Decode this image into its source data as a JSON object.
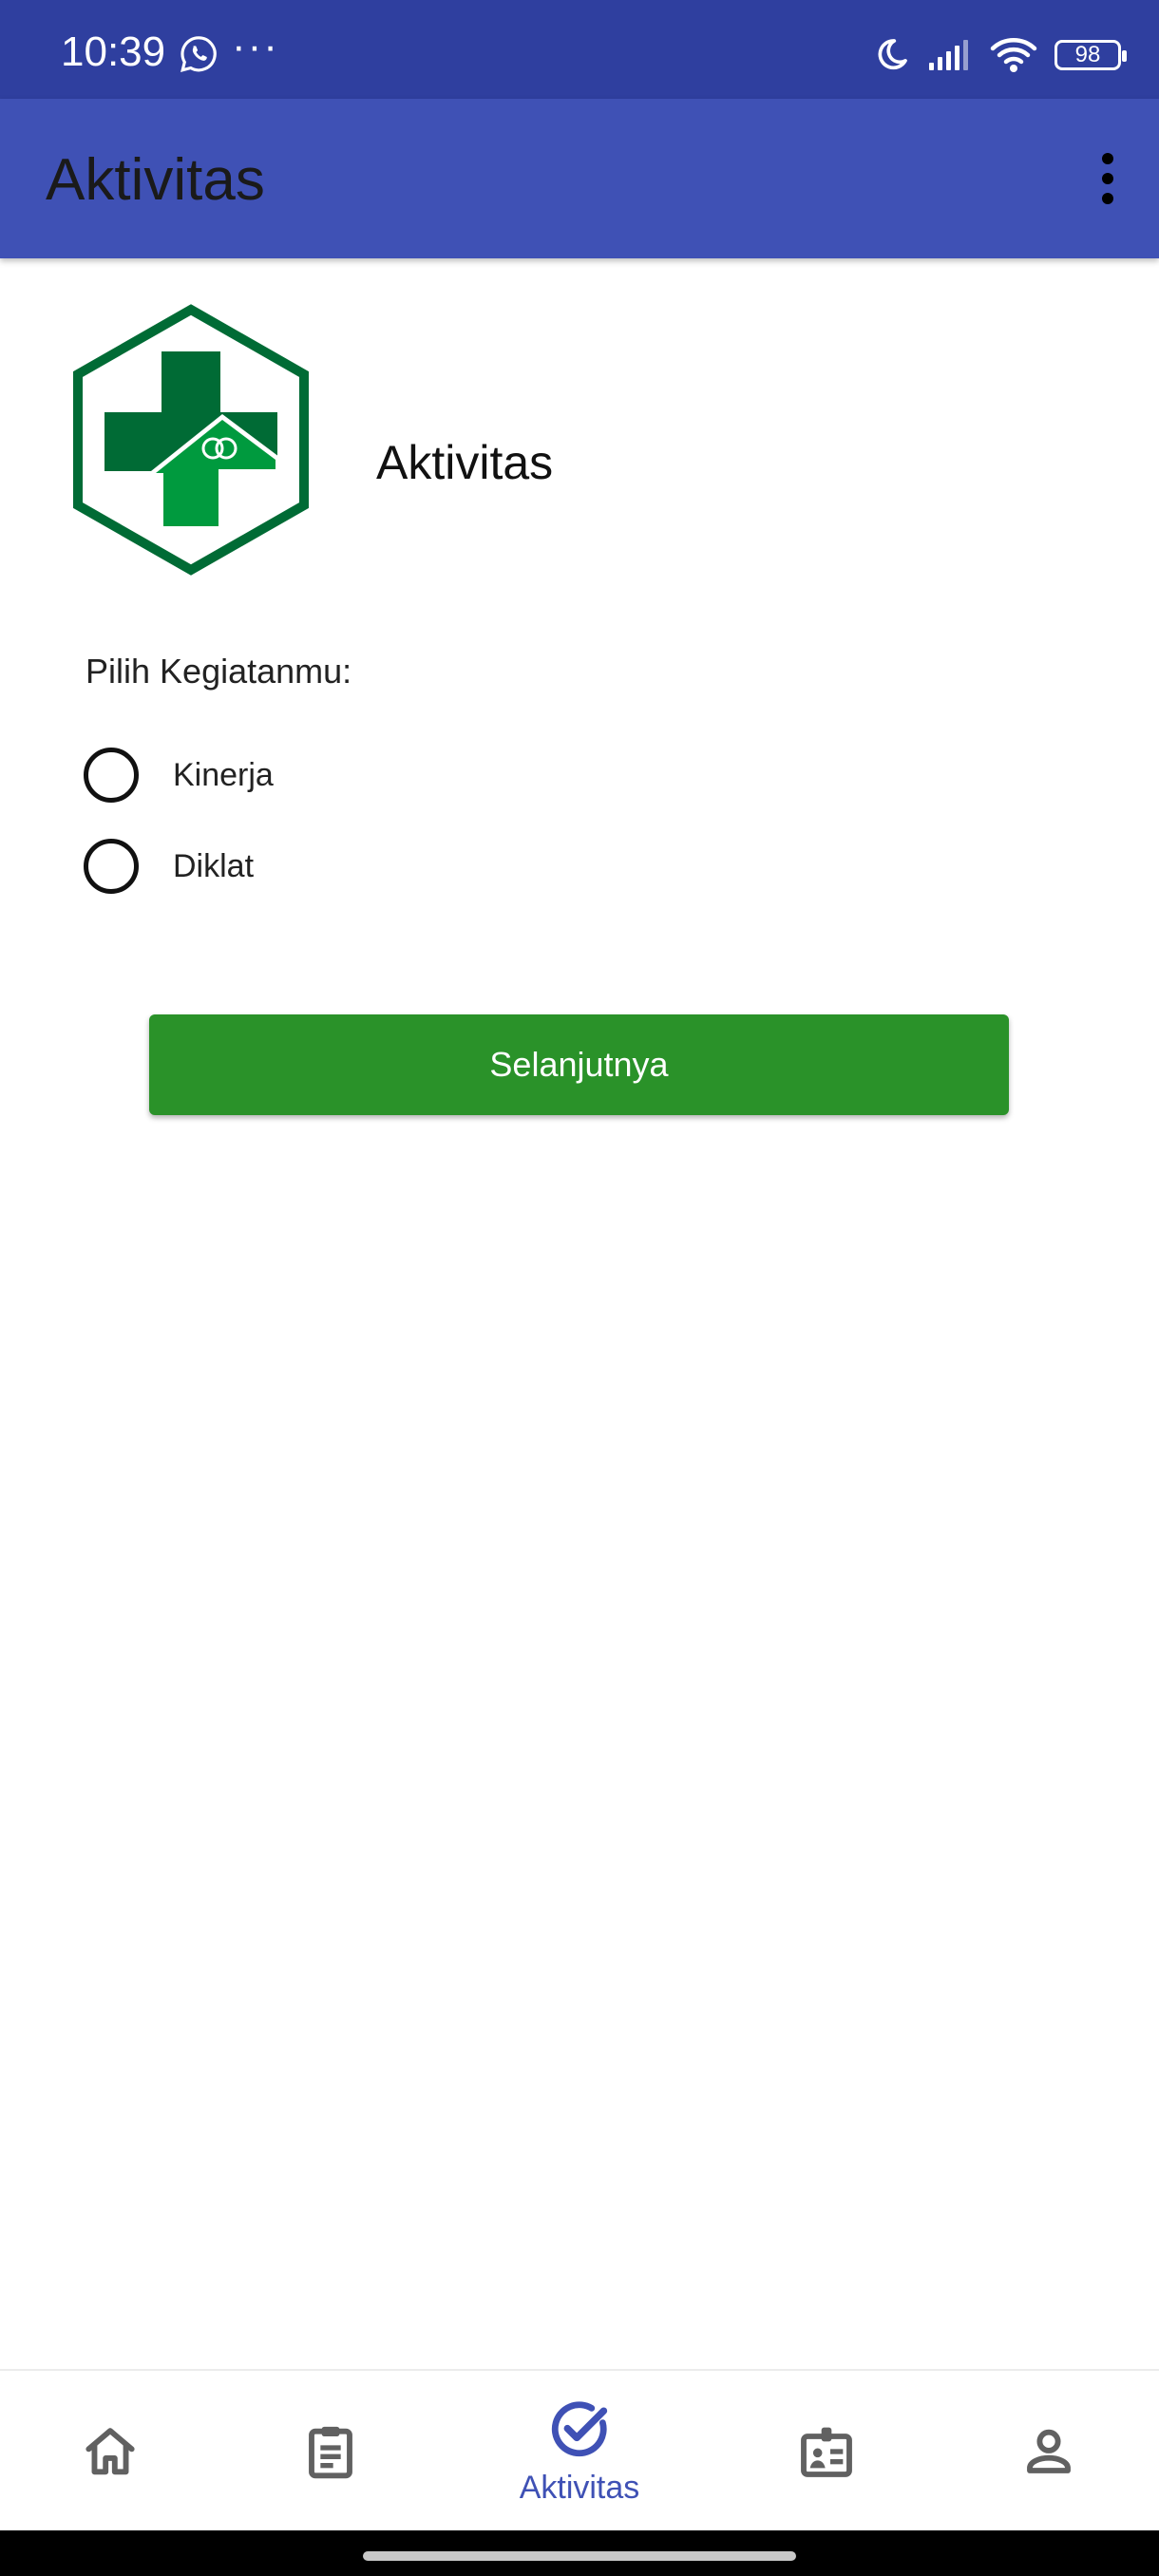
{
  "status_bar": {
    "time": "10:39",
    "dots": "···",
    "battery": "98"
  },
  "app_bar": {
    "title": "Aktivitas"
  },
  "content": {
    "heading": "Aktivitas",
    "prompt": "Pilih Kegiatanmu:",
    "options": [
      {
        "label": "Kinerja",
        "selected": false
      },
      {
        "label": "Diklat",
        "selected": false
      }
    ],
    "next_button": "Selanjutnya"
  },
  "bottom_nav": {
    "items": [
      {
        "icon": "home-icon",
        "label": "",
        "active": false
      },
      {
        "icon": "clipboard-icon",
        "label": "",
        "active": false
      },
      {
        "icon": "check-circle-icon",
        "label": "Aktivitas",
        "active": true
      },
      {
        "icon": "id-card-icon",
        "label": "",
        "active": false
      },
      {
        "icon": "person-icon",
        "label": "",
        "active": false
      }
    ]
  },
  "colors": {
    "status_bar": "#2f3f9f",
    "app_bar": "#3f51b5",
    "primary_button": "#2a9229",
    "logo_dark_green": "#006b35",
    "logo_light_green": "#009a3e",
    "nav_active": "#3f51b5",
    "nav_inactive": "#616161"
  }
}
